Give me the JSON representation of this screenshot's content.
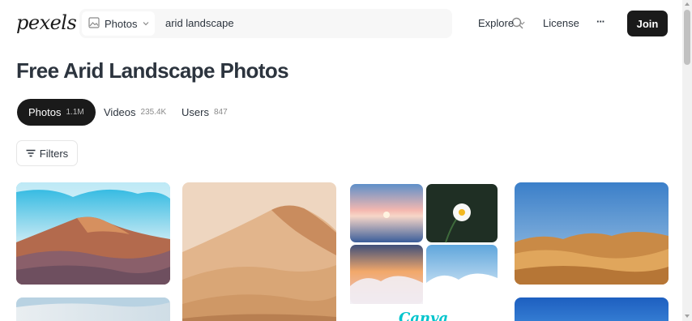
{
  "header": {
    "logo": "pexels",
    "search_type": "Photos",
    "search_query": "arid landscape",
    "nav_explore": "Explore",
    "nav_license": "License",
    "nav_more": "···",
    "join": "Join"
  },
  "page": {
    "title": "Free Arid Landscape Photos"
  },
  "tabs": [
    {
      "label": "Photos",
      "count": "1.1M",
      "active": true
    },
    {
      "label": "Videos",
      "count": "235.4K",
      "active": false
    },
    {
      "label": "Users",
      "count": "847",
      "active": false
    }
  ],
  "filters": {
    "label": "Filters"
  },
  "ad": {
    "brand": "Canva"
  },
  "colors": {
    "primary": "#1a1a1a",
    "canva_brand": "#00c4cc"
  }
}
